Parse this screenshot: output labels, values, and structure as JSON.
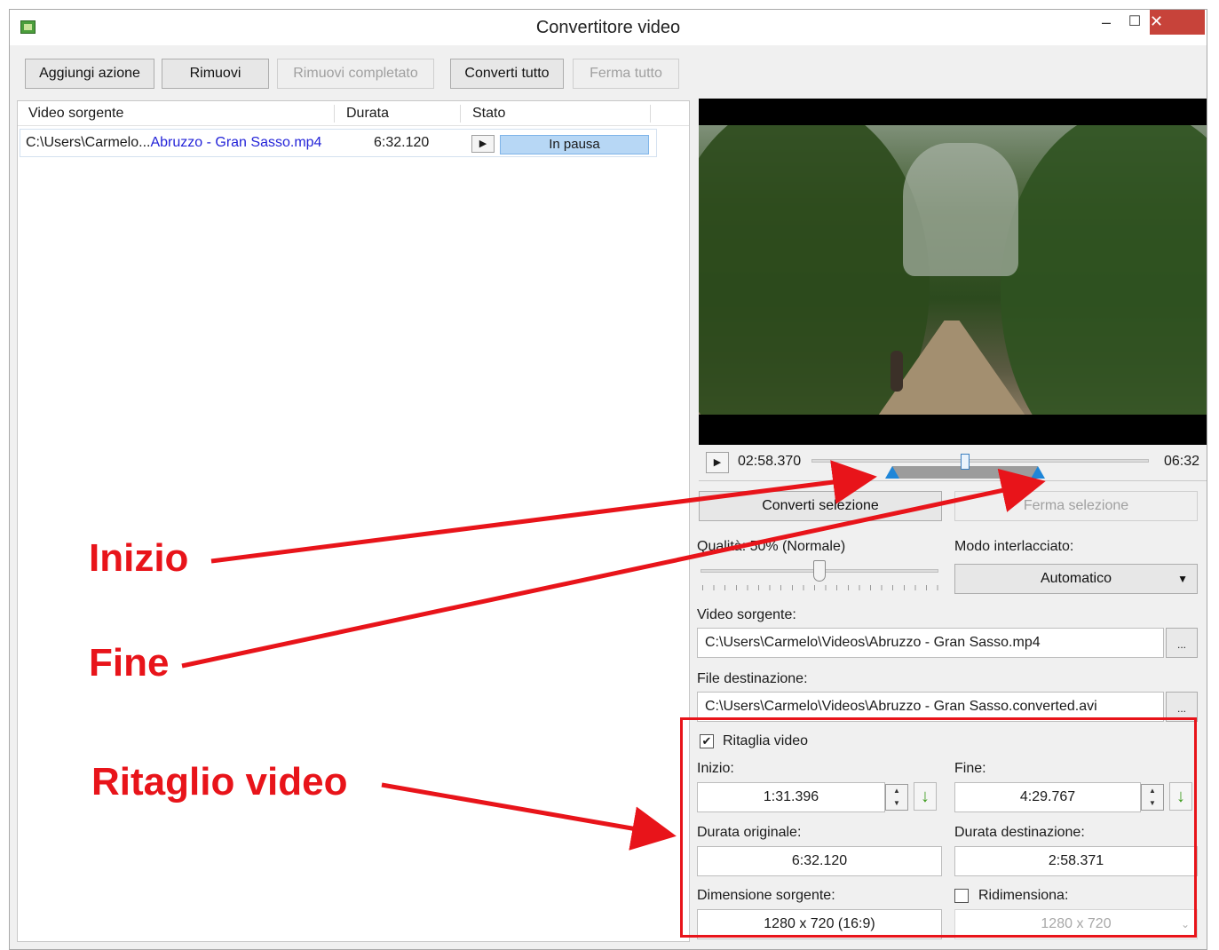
{
  "window": {
    "title": "Convertitore video",
    "minimize": "–",
    "maximize": "☐",
    "close": "✕"
  },
  "toolbar": {
    "add_action": "Aggiungi azione",
    "remove": "Rimuovi",
    "remove_completed": "Rimuovi completato",
    "convert_all": "Converti tutto",
    "stop_all": "Ferma tutto"
  },
  "list": {
    "columns": [
      "Video sorgente",
      "Durata",
      "Stato"
    ],
    "rows": [
      {
        "source_prefix": "C:\\Users\\Carmelo...",
        "source_name": "Abruzzo - Gran Sasso.mp4",
        "duration": "6:32.120",
        "status": "In pausa"
      }
    ]
  },
  "player": {
    "current_time": "02:58.370",
    "total_time": "06:32",
    "position_fraction": 0.455,
    "selection_start_fraction": 0.24,
    "selection_end_fraction": 0.67
  },
  "actions": {
    "convert_selection": "Converti selezione",
    "stop_selection": "Ferma selezione"
  },
  "quality": {
    "label": "Qualità: 50% (Normale)",
    "value_percent": 50
  },
  "interlace": {
    "label": "Modo interlacciato:",
    "value": "Automatico"
  },
  "source": {
    "label": "Video sorgente:",
    "path": "C:\\Users\\Carmelo\\Videos\\Abruzzo - Gran Sasso.mp4",
    "browse": "..."
  },
  "destination": {
    "label": "File destinazione:",
    "path": "C:\\Users\\Carmelo\\Videos\\Abruzzo - Gran Sasso.converted.avi",
    "browse": "..."
  },
  "trim": {
    "label": "Ritaglia video",
    "checked": true,
    "start_label": "Inizio:",
    "start_value": "1:31.396",
    "end_label": "Fine:",
    "end_value": "4:29.767",
    "orig_duration_label": "Durata originale:",
    "orig_duration_value": "6:32.120",
    "dest_duration_label": "Durata destinazione:",
    "dest_duration_value": "2:58.371",
    "source_size_label": "Dimensione sorgente:",
    "source_size_value": "1280 x 720 (16:9)",
    "resize_label": "Ridimensiona:",
    "resize_checked": false,
    "resize_value": "1280 x 720"
  },
  "annotations": {
    "start": "Inizio",
    "end": "Fine",
    "trim": "Ritaglio video",
    "color": "#e8141a"
  },
  "colors": {
    "accent": "#2a7fd4",
    "close": "#c7433a",
    "status_bar": "#b7d7f5"
  }
}
